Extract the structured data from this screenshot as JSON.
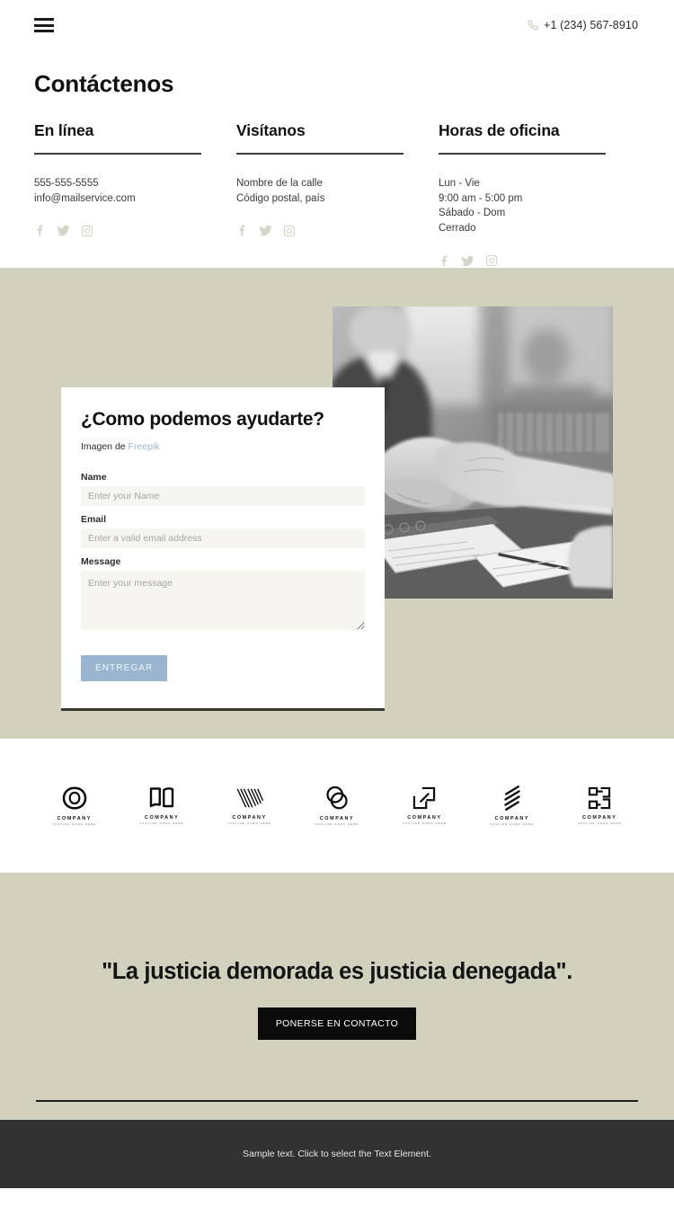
{
  "header": {
    "menu_icon": "hamburger-menu-icon",
    "phone_icon": "phone-icon",
    "phone": "+1 (234) 567-8910"
  },
  "contact": {
    "title": "Contáctenos",
    "columns": [
      {
        "title": "En línea",
        "lines": [
          "555-555-5555",
          "info@mailservice.com"
        ],
        "socials": [
          "facebook-icon",
          "twitter-icon",
          "instagram-icon"
        ]
      },
      {
        "title": "Visítanos",
        "lines": [
          "Nombre de la calle",
          "Código postal, país"
        ],
        "socials": [
          "facebook-icon",
          "twitter-icon",
          "instagram-icon"
        ]
      },
      {
        "title": "Horas de oficina",
        "lines": [
          "Lun - Vie",
          "9:00 am - 5:00 pm",
          "Sábado - Dom",
          "Cerrado"
        ],
        "socials": [
          "facebook-icon",
          "twitter-icon",
          "instagram-icon"
        ]
      }
    ]
  },
  "form": {
    "title": "¿Como podemos ayudarte?",
    "attribution_prefix": "Imagen de",
    "attribution_link": "Freepik",
    "fields": [
      {
        "label": "Name",
        "placeholder": "Enter your Name",
        "value": ""
      },
      {
        "label": "Email",
        "placeholder": "Enter a valid email address",
        "value": ""
      },
      {
        "label": "Message",
        "placeholder": "Enter your message",
        "value": ""
      }
    ],
    "submit_label": "ENTREGAR"
  },
  "photo": {
    "alt": "grayscale photo of two people shaking hands over a desk in an office"
  },
  "logos": [
    {
      "word": "COMPANY",
      "sub": "TAGLINE GOES HERE",
      "mark": "overlapping-leaf-circle-logo"
    },
    {
      "word": "COMPANY",
      "sub": "TAGLINE GOES HERE",
      "mark": "open-book-logo"
    },
    {
      "word": "COMPANY",
      "sub": "TAGLINE GOES HERE",
      "mark": "striped-chevron-logo"
    },
    {
      "word": "COMPANY",
      "sub": "TAGLINE GOES HERE",
      "mark": "double-circle-logo"
    },
    {
      "word": "COMPANY",
      "sub": "TAGLINE GOES HERE",
      "mark": "nested-squares-logo"
    },
    {
      "word": "COMPANY",
      "sub": "TAGLINE GOES HERE",
      "mark": "diagonal-stripes-logo"
    },
    {
      "word": "COMPANY",
      "sub": "TAGLINE GOES HERE",
      "mark": "split-block-logo"
    }
  ],
  "quote": {
    "text": "\"La justicia demorada es justicia denegada\".",
    "cta_label": "PONERSE EN CONTACTO"
  },
  "footer": {
    "text": "Sample text. Click to select the Text Element."
  },
  "colors": {
    "beige_section": "#d2d1be",
    "page_background": "#ffffff",
    "footer_background": "#323232",
    "submit_button": "#9ab5cf",
    "cta_button": "#0b0b0b",
    "input_background": "#f7f5f0",
    "social_icon": "#d6d4c7",
    "link": "#9cb6cd"
  }
}
